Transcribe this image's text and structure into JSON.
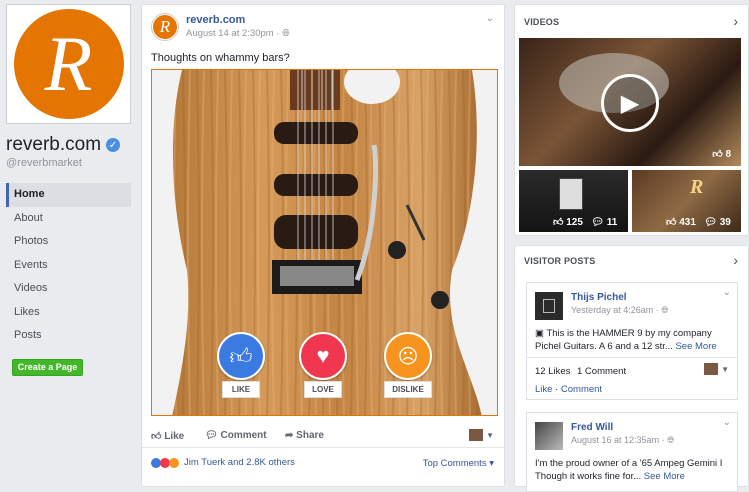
{
  "page": {
    "name": "reverb.com",
    "handle": "@reverbmarket",
    "logo_letter": "R",
    "brand_color": "#e37500"
  },
  "nav": {
    "items": [
      {
        "label": "Home"
      },
      {
        "label": "About"
      },
      {
        "label": "Photos"
      },
      {
        "label": "Events"
      },
      {
        "label": "Videos"
      },
      {
        "label": "Likes"
      },
      {
        "label": "Posts"
      }
    ],
    "create_page": "Create a Page"
  },
  "post": {
    "author": "reverb.com",
    "time": "August 14 at 2:30pm · ",
    "text": "Thoughts on whammy bars?",
    "reactions": [
      {
        "label": "LIKE",
        "icon": "thumbs-up-icon",
        "color": "#3b7ae0"
      },
      {
        "label": "LOVE",
        "icon": "heart-icon",
        "color": "#f0374f"
      },
      {
        "label": "DISLIKE",
        "icon": "angry-face-icon",
        "color": "#f7941d"
      }
    ],
    "actions": {
      "like": "Like",
      "comment": "Comment",
      "share": "Share"
    },
    "reacted_by": "Jim Tuerk and 2.8K others",
    "top_comments": "Top Comments"
  },
  "videos": {
    "title": "VIDEOS",
    "main_likes": "8",
    "thumbs": [
      {
        "likes": "125",
        "comments": "11"
      },
      {
        "likes": "431",
        "comments": "39"
      }
    ]
  },
  "visitor_posts": {
    "title": "VISITOR POSTS",
    "posts": [
      {
        "name": "Thijs Pichel",
        "time": "Yesterday at 4:26am · ",
        "text": "This is the HAMMER 9 by my company Pichel Guitars. A 6 and a 12 str... ",
        "see_more": "See More",
        "likes": "12 Likes",
        "comments": "1 Comment",
        "like_link": "Like",
        "comment_link": "Comment"
      },
      {
        "name": "Fred Will",
        "time": "August 16 at 12:35am · ",
        "text": "I'm the proud owner of a '65 Ampeg Gemini I Though it works fine for... ",
        "see_more": "See More"
      }
    ]
  }
}
